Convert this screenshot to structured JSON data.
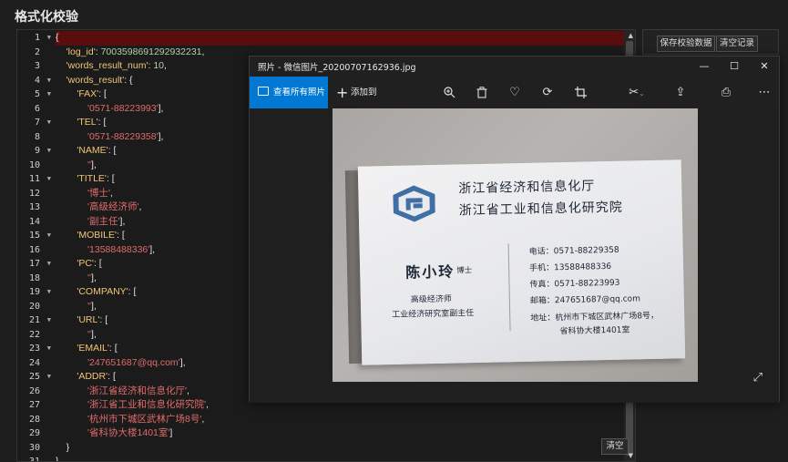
{
  "page": {
    "title": "格式化校验"
  },
  "editor": {
    "lines": [
      [
        {
          "t": "{",
          "c": "p"
        }
      ],
      [
        {
          "t": "    ",
          "c": "p"
        },
        {
          "t": "'log_id'",
          "c": "k"
        },
        {
          "t": ": ",
          "c": "p"
        },
        {
          "t": "7003598691292932231",
          "c": "n"
        },
        {
          "t": ",",
          "c": "p"
        }
      ],
      [
        {
          "t": "    ",
          "c": "p"
        },
        {
          "t": "'words_result_num'",
          "c": "k"
        },
        {
          "t": ": ",
          "c": "p"
        },
        {
          "t": "10",
          "c": "n"
        },
        {
          "t": ",",
          "c": "p"
        }
      ],
      [
        {
          "t": "    ",
          "c": "p"
        },
        {
          "t": "'words_result'",
          "c": "k"
        },
        {
          "t": ": {",
          "c": "p"
        }
      ],
      [
        {
          "t": "        ",
          "c": "p"
        },
        {
          "t": "'FAX'",
          "c": "k"
        },
        {
          "t": ": [",
          "c": "p"
        }
      ],
      [
        {
          "t": "            ",
          "c": "p"
        },
        {
          "t": "'0571-88223993'",
          "c": "s"
        },
        {
          "t": "],",
          "c": "p"
        }
      ],
      [
        {
          "t": "        ",
          "c": "p"
        },
        {
          "t": "'TEL'",
          "c": "k"
        },
        {
          "t": ": [",
          "c": "p"
        }
      ],
      [
        {
          "t": "            ",
          "c": "p"
        },
        {
          "t": "'0571-88229358'",
          "c": "s"
        },
        {
          "t": "],",
          "c": "p"
        }
      ],
      [
        {
          "t": "        ",
          "c": "p"
        },
        {
          "t": "'NAME'",
          "c": "k"
        },
        {
          "t": ": [",
          "c": "p"
        }
      ],
      [
        {
          "t": "            ",
          "c": "p"
        },
        {
          "t": "''",
          "c": "s"
        },
        {
          "t": "],",
          "c": "p"
        }
      ],
      [
        {
          "t": "        ",
          "c": "p"
        },
        {
          "t": "'TITLE'",
          "c": "k"
        },
        {
          "t": ": [",
          "c": "p"
        }
      ],
      [
        {
          "t": "            ",
          "c": "p"
        },
        {
          "t": "'博士'",
          "c": "s"
        },
        {
          "t": ",",
          "c": "p"
        }
      ],
      [
        {
          "t": "            ",
          "c": "p"
        },
        {
          "t": "'高级经济师'",
          "c": "s"
        },
        {
          "t": ",",
          "c": "p"
        }
      ],
      [
        {
          "t": "            ",
          "c": "p"
        },
        {
          "t": "'副主任'",
          "c": "s"
        },
        {
          "t": "],",
          "c": "p"
        }
      ],
      [
        {
          "t": "        ",
          "c": "p"
        },
        {
          "t": "'MOBILE'",
          "c": "k"
        },
        {
          "t": ": [",
          "c": "p"
        }
      ],
      [
        {
          "t": "            ",
          "c": "p"
        },
        {
          "t": "'13588488336'",
          "c": "s"
        },
        {
          "t": "],",
          "c": "p"
        }
      ],
      [
        {
          "t": "        ",
          "c": "p"
        },
        {
          "t": "'PC'",
          "c": "k"
        },
        {
          "t": ": [",
          "c": "p"
        }
      ],
      [
        {
          "t": "            ",
          "c": "p"
        },
        {
          "t": "''",
          "c": "s"
        },
        {
          "t": "],",
          "c": "p"
        }
      ],
      [
        {
          "t": "        ",
          "c": "p"
        },
        {
          "t": "'COMPANY'",
          "c": "k"
        },
        {
          "t": ": [",
          "c": "p"
        }
      ],
      [
        {
          "t": "            ",
          "c": "p"
        },
        {
          "t": "''",
          "c": "s"
        },
        {
          "t": "],",
          "c": "p"
        }
      ],
      [
        {
          "t": "        ",
          "c": "p"
        },
        {
          "t": "'URL'",
          "c": "k"
        },
        {
          "t": ": [",
          "c": "p"
        }
      ],
      [
        {
          "t": "            ",
          "c": "p"
        },
        {
          "t": "''",
          "c": "s"
        },
        {
          "t": "],",
          "c": "p"
        }
      ],
      [
        {
          "t": "        ",
          "c": "p"
        },
        {
          "t": "'EMAIL'",
          "c": "k"
        },
        {
          "t": ": [",
          "c": "p"
        }
      ],
      [
        {
          "t": "            ",
          "c": "p"
        },
        {
          "t": "'247651687@qq.com'",
          "c": "s"
        },
        {
          "t": "],",
          "c": "p"
        }
      ],
      [
        {
          "t": "        ",
          "c": "p"
        },
        {
          "t": "'ADDR'",
          "c": "k"
        },
        {
          "t": ": [",
          "c": "p"
        }
      ],
      [
        {
          "t": "            ",
          "c": "p"
        },
        {
          "t": "'浙江省经济和信息化厅'",
          "c": "s"
        },
        {
          "t": ",",
          "c": "p"
        }
      ],
      [
        {
          "t": "            ",
          "c": "p"
        },
        {
          "t": "'浙江省工业和信息化研究院'",
          "c": "s"
        },
        {
          "t": ",",
          "c": "p"
        }
      ],
      [
        {
          "t": "            ",
          "c": "p"
        },
        {
          "t": "'杭州市下城区武林广场8号'",
          "c": "s"
        },
        {
          "t": ",",
          "c": "p"
        }
      ],
      [
        {
          "t": "            ",
          "c": "p"
        },
        {
          "t": "'省科协大楼1401室'",
          "c": "s"
        },
        {
          "t": "]",
          "c": "p"
        }
      ],
      [
        {
          "t": "    }",
          "c": "p"
        }
      ],
      [
        {
          "t": "}",
          "c": "p"
        }
      ]
    ],
    "line_numbers": [
      "1",
      "2",
      "3",
      "4",
      "5",
      "6",
      "7",
      "8",
      "9",
      "10",
      "11",
      "12",
      "13",
      "14",
      "15",
      "16",
      "17",
      "18",
      "19",
      "20",
      "21",
      "22",
      "23",
      "24",
      "25",
      "26",
      "27",
      "28",
      "29",
      "30",
      "31"
    ],
    "foldable_lines": [
      1,
      4,
      5,
      7,
      9,
      11,
      15,
      17,
      19,
      21,
      23,
      25
    ],
    "clear_button": "清空"
  },
  "right_panel": {
    "save_button": "保存校验数据",
    "clear_records_button": "清空记录"
  },
  "photos_window": {
    "title": "照片 - 微信图片_20200707162936.jpg",
    "view_all": "查看所有照片",
    "add_to": "添加到",
    "accent": "#0078d4"
  },
  "card": {
    "org1": "浙江省经济和信息化厅",
    "org2": "浙江省工业和信息化研究院",
    "name": "陈小玲",
    "degree": "博士",
    "role1": "高级经济师",
    "role2": "工业经济研究室副主任",
    "tel": "电话：0571-88229358",
    "mobile": "手机：13588488336",
    "fax": "传真：0571-88223993",
    "email": "邮箱：247651687@qq.com",
    "addr1": "地址：杭州市下城区武林广场8号，",
    "addr2": "省科协大楼1401室"
  }
}
